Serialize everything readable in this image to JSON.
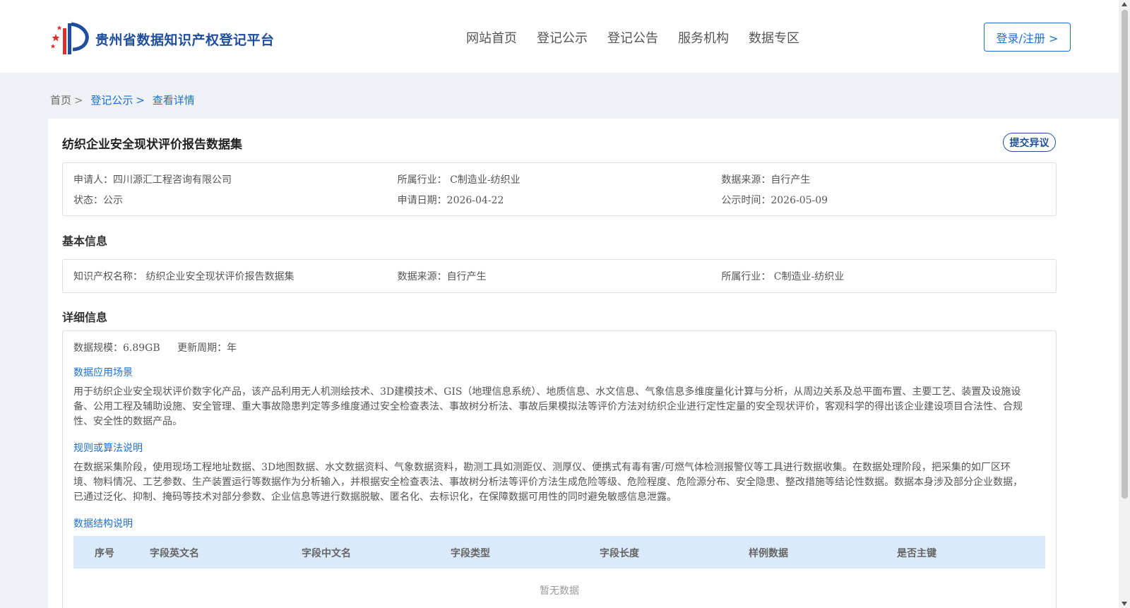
{
  "header": {
    "site_title": "贵州省数据知识产权登记平台",
    "nav": [
      "网站首页",
      "登记公示",
      "登记公告",
      "服务机构",
      "数据专区"
    ],
    "login_label": "登录/注册 >"
  },
  "breadcrumb": {
    "home": "首页",
    "list": "登记公示",
    "current": "查看详情",
    "sep": ">"
  },
  "detail": {
    "title": "纺织企业安全现状评价报告数据集",
    "objection_label": "提交异议",
    "summary": {
      "applicant": "申请人：四川源汇工程咨询有限公司",
      "industry": "所属行业： C制造业-纺织业",
      "source": "数据来源：自行产生",
      "status": "状态：公示",
      "apply_date": "申请日期：2026-04-22",
      "publish_date": "公示时间：2026-05-09"
    },
    "basic_title": "基本信息",
    "basic": {
      "ip_name": "知识产权名称： 纺织企业安全现状评价报告数据集",
      "source": "数据来源：自行产生",
      "industry": "所属行业： C制造业-纺织业"
    },
    "detail_title": "详细信息",
    "scale": "数据规模：6.89GB",
    "cycle": "更新周期：年",
    "scenario_title": "数据应用场景",
    "scenario_text": "用于纺织企业安全现状评价数字化产品，该产品利用无人机测绘技术、3D建模技术、GIS（地理信息系统）、地质信息、水文信息、气象信息多维度量化计算与分析，从周边关系及总平面布置、主要工艺、装置及设施设备、公用工程及辅助设施、安全管理、重大事故隐患判定等多维度通过安全检查表法、事故树分析法、事故后果模拟法等评价方法对纺织企业进行定性定量的安全现状评价，客观科学的得出该企业建设项目合法性、合规性、安全性的数据产品。",
    "rules_title": "规则或算法说明",
    "rules_text": "在数据采集阶段，使用现场工程地址数据、3D地图数据、水文数据资料、气象数据资料，勘测工具如测距仪、测厚仪、便携式有毒有害/可燃气体检测报警仪等工具进行数据收集。在数据处理阶段，把采集的如厂区环境、物料情况、工艺参数、生产装置运行等数据作为分析输入，并根据安全检查表法、事故树分析法等评价方法生成危险等级、危险程度、危险源分布、安全隐患、整改措施等结论性数据。数据本身涉及部分企业数据，已通过泛化、抑制、掩码等技术对部分参数、企业信息等进行数据脱敏、匿名化、去标识化，在保障数据可用性的同时避免敏感信息泄露。",
    "structure_title": "数据结构说明",
    "table_headers": [
      "序号",
      "字段英文名",
      "字段中文名",
      "字段类型",
      "字段长度",
      "样例数据",
      "是否主键"
    ],
    "empty_text": "暂无数据"
  },
  "colors": {
    "brand": "#1f4f9c",
    "link": "#1f6fd0",
    "table_head_bg": "#dbeafb"
  },
  "icons": {
    "logo": "flag-stars-logo"
  }
}
